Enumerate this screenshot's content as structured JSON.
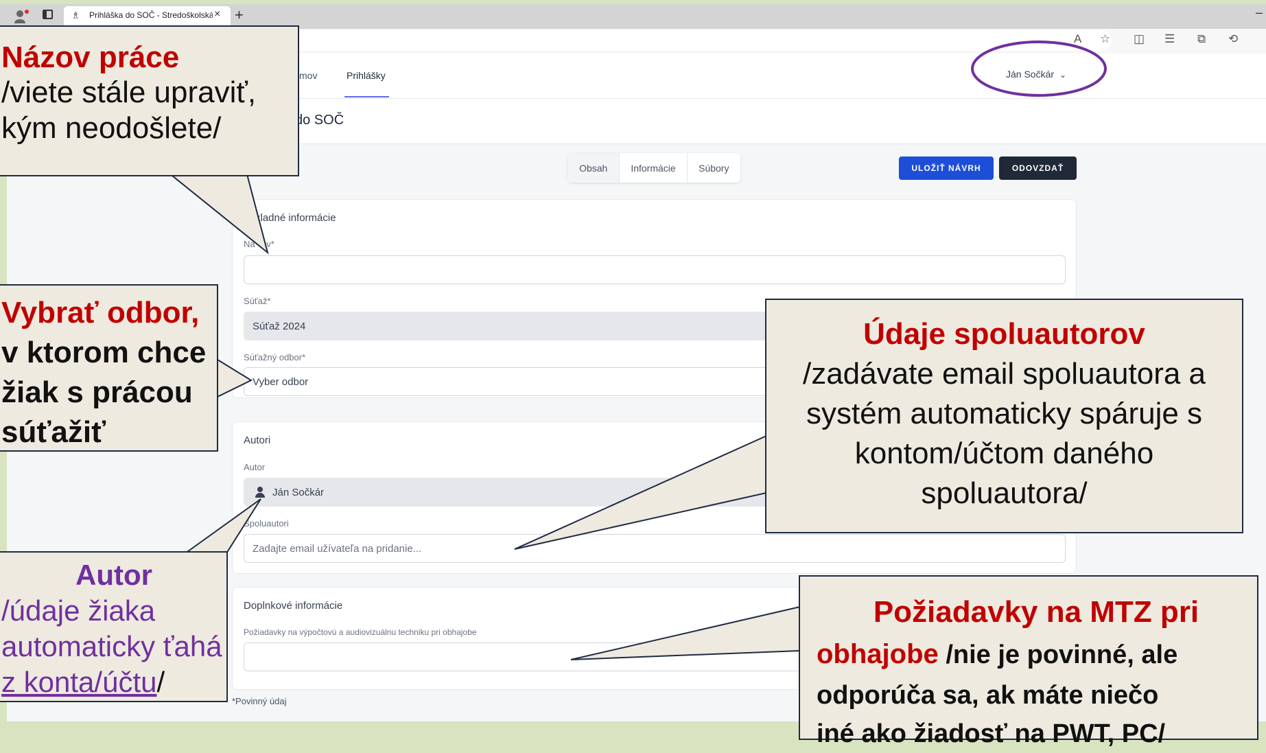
{
  "browser": {
    "tab_title": "Prihláška do SOČ - Stredoškolská",
    "tab_close": "×",
    "new_tab": "+",
    "window_min": "–"
  },
  "nav": {
    "link_partial": "mov",
    "link_active": "Prihlášky",
    "user_name": "Ján Sočkár",
    "user_chevron": "⌄"
  },
  "page": {
    "title_partial": "do SOČ",
    "tabs": [
      "Obsah",
      "Informácie",
      "Súbory"
    ],
    "save_button": "ULOŽIŤ NÁVRH",
    "submit_button": "ODOVZDAŤ"
  },
  "basic_info": {
    "title_partial": "kladné informácie",
    "name_label_partial": "Na",
    "name_label_end": "ov*",
    "name_value": "",
    "competition_label": "Súťaž*",
    "competition_value": "Súťaž 2024",
    "field_label": "Súťažný odbor*",
    "field_placeholder": "Vyber odbor"
  },
  "authors": {
    "title": "Autori",
    "author_label": "Autor",
    "author_value": "Ján Sočkár",
    "coauthors_label": "Spoluautori",
    "coauthors_placeholder": "Zadajte email užívateľa na pridanie..."
  },
  "extra": {
    "title": "Doplnkové informácie",
    "mtz_label": "Požiadavky na výpočtovú a audiovizuálnu techniku pri obhajobe",
    "mtz_value": ""
  },
  "required_note": "*Povinný údaj",
  "callouts": {
    "title_work": {
      "heading": "Názov práce",
      "line1": "/viete stále upraviť,",
      "line2": "kým neodošlete/"
    },
    "field": {
      "line1": "Vybrať odbor,",
      "line2": "v ktorom chce",
      "line3": "žiak s prácou",
      "line4": "súťažiť"
    },
    "author": {
      "heading": "Autor",
      "line1": "/údaje žiaka",
      "line2": "automaticky ťahá",
      "line3": "z konta/účtu",
      "line3_end": "/"
    },
    "coauthors": {
      "heading": "Údaje spoluautorov",
      "body": "/zadávate email spoluautora a systém automaticky spáruje s kontom/účtom daného spoluautora/"
    },
    "mtz": {
      "heading1": "Požiadavky na MTZ pri",
      "heading2": "obhajobe",
      "rest1": " /nie je povinné, ale",
      "line3": "odporúča sa, ak máte niečo",
      "line4": "iné ako žiadosť na PWT, PC/"
    }
  },
  "colors": {
    "accent_blue": "#1d4ed8",
    "dark_button": "#1f2937",
    "callout_red": "#c00000",
    "callout_purple": "#7030a0",
    "callout_bg": "#eeeadf",
    "ellipse": "#7030a0"
  }
}
